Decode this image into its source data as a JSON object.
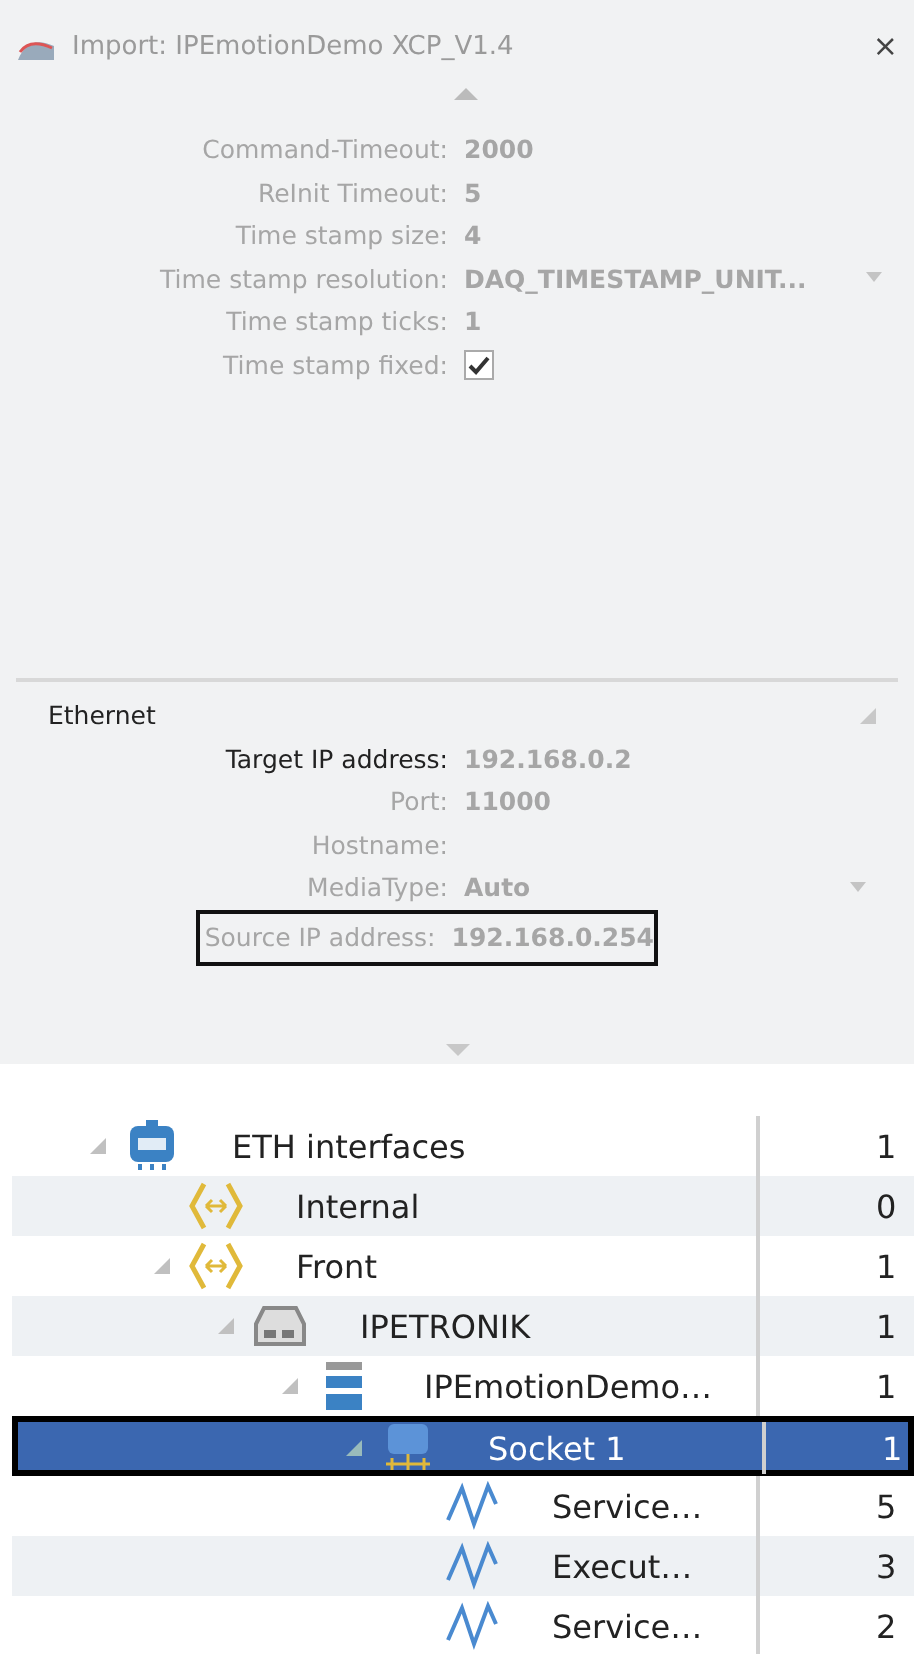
{
  "window": {
    "title": "Import: IPEmotionDemo XCP_V1.4",
    "close_label": "×"
  },
  "properties": [
    {
      "kind": "text",
      "label": "Command-Timeout:",
      "value": "2000",
      "emphasized": false,
      "dropdown": false,
      "outlined": false
    },
    {
      "kind": "text",
      "label": "ReInit Timeout:",
      "value": "5",
      "emphasized": false,
      "dropdown": false,
      "outlined": false
    },
    {
      "kind": "text",
      "label": "Time stamp size:",
      "value": "4",
      "emphasized": false,
      "dropdown": false,
      "outlined": false
    },
    {
      "kind": "text",
      "label": "Time stamp resolution:",
      "value": "DAQ_TIMESTAMP_UNIT...",
      "emphasized": false,
      "dropdown": true,
      "outlined": false
    },
    {
      "kind": "text",
      "label": "Time stamp ticks:",
      "value": "1",
      "emphasized": false,
      "dropdown": false,
      "outlined": false
    },
    {
      "kind": "checkbox",
      "label": "Time stamp fixed:",
      "checked": true,
      "emphasized": false,
      "dropdown": false,
      "outlined": false
    }
  ],
  "ethernet": {
    "title": "Ethernet",
    "properties": [
      {
        "kind": "text",
        "label": "Target IP address:",
        "value": "192.168.0.2",
        "emphasized": true,
        "dropdown": false,
        "outlined": false
      },
      {
        "kind": "text",
        "label": "Port:",
        "value": "11000",
        "emphasized": false,
        "dropdown": false,
        "outlined": false
      },
      {
        "kind": "text",
        "label": "Hostname:",
        "emphasized": false,
        "dropdown": false,
        "outlined": false
      },
      {
        "kind": "text",
        "label": "MediaType:",
        "value": "Auto",
        "emphasized": false,
        "dropdown": true,
        "outlined": false
      },
      {
        "kind": "text",
        "label": "Source IP address:",
        "value": "192.168.0.254",
        "emphasized": false,
        "dropdown": false,
        "outlined": true
      }
    ]
  },
  "tree": [
    {
      "kind": "eth",
      "label": "ETH interfaces",
      "count": "1",
      "expanded": true,
      "selected": false,
      "children": [
        {
          "kind": "port",
          "label": "Internal",
          "count": "0",
          "selected": false
        },
        {
          "kind": "port",
          "label": "Front",
          "count": "1",
          "expanded": true,
          "selected": false,
          "children": [
            {
              "kind": "device",
              "label": "IPETRONIK",
              "count": "1",
              "expanded": true,
              "selected": false,
              "children": [
                {
                  "kind": "module",
                  "label": "IPEmotionDemo…",
                  "count": "1",
                  "expanded": true,
                  "selected": false,
                  "children": [
                    {
                      "kind": "socket",
                      "label": "Socket 1",
                      "count": "1",
                      "expanded": true,
                      "selected": true,
                      "children": [
                        {
                          "kind": "signal",
                          "label": "Service…",
                          "count": "5",
                          "selected": false
                        },
                        {
                          "kind": "signal",
                          "label": "Execut…",
                          "count": "3",
                          "selected": false
                        },
                        {
                          "kind": "signal",
                          "label": "Service…",
                          "count": "2",
                          "selected": false
                        }
                      ]
                    }
                  ]
                }
              ]
            }
          ]
        }
      ]
    }
  ]
}
